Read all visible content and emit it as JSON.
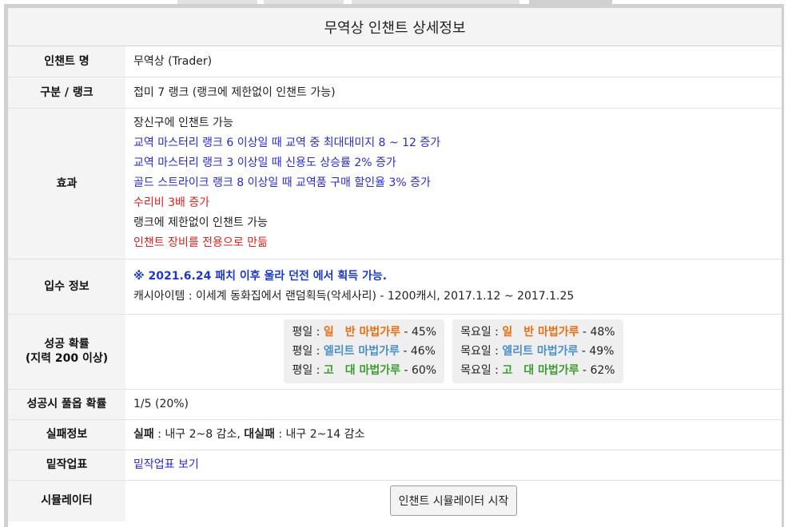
{
  "title": "무역상 인챈트 상세정보",
  "rows": {
    "name": {
      "label": "인챈트 명",
      "value": "무역상 (Trader)"
    },
    "rank": {
      "label": "구분 / 랭크",
      "value": "접미 7 랭크 (랭크에 제한없이 인챈트 가능)"
    },
    "effect": {
      "label": "효과",
      "lines": [
        "장신구에 인챈트 가능",
        "교역 마스터리 랭크 6 이상일 때 교역 중 최대대미지 8 ~ 12 증가",
        "교역 마스터리 랭크 3 이상일 때 신용도 상승률 2% 증가",
        "골드 스트라이크 랭크 8 이상일 때 교역품 구매 할인율 3% 증가",
        "수리비 3배 증가",
        "랭크에 제한없이 인챈트 가능",
        "인챈트 장비를 전용으로 만듦"
      ]
    },
    "source": {
      "label": "입수 정보",
      "notice": "※ 2021.6.24 패치 이후 울라 던전 에서 획득 가능.",
      "detail": "캐시아이템 : 이세계 동화집에서 랜덤획득(악세사리) - 1200캐시, 2017.1.12 ~ 2017.1.25"
    },
    "success": {
      "label": "성공 확률",
      "label_sub": "(지력 200 이상)",
      "weekday": {
        "day": "평일",
        "items": [
          {
            "name": "일　반 마법가루",
            "rate": "45%"
          },
          {
            "name": "엘리트 마법가루",
            "rate": "46%"
          },
          {
            "name": "고　대 마법가루",
            "rate": "60%"
          }
        ]
      },
      "thursday": {
        "day": "목요일",
        "items": [
          {
            "name": "일　반 마법가루",
            "rate": "48%"
          },
          {
            "name": "엘리트 마법가루",
            "rate": "49%"
          },
          {
            "name": "고　대 마법가루",
            "rate": "62%"
          }
        ]
      }
    },
    "fullopt": {
      "label": "성공시 풀옵 확률",
      "value": "1/5 (20%)"
    },
    "fail": {
      "label": "실패정보",
      "fail_label": "실패",
      "fail_value": "내구 2~8 감소",
      "bigfail_label": "대실패",
      "bigfail_value": "내구 2~14 감소"
    },
    "baseplate": {
      "label": "밑작업표",
      "link": "밑작업표 보기"
    },
    "simulator": {
      "label": "시뮬레이터",
      "button": "인챈트 시뮬레이터 시작"
    }
  },
  "colors": {
    "blue_text": "#2a2ad4",
    "red_text": "#e0201c",
    "normal_powder": "#e86d12",
    "elite_powder": "#4a8fc8",
    "ancient_powder": "#3b9b2f"
  }
}
